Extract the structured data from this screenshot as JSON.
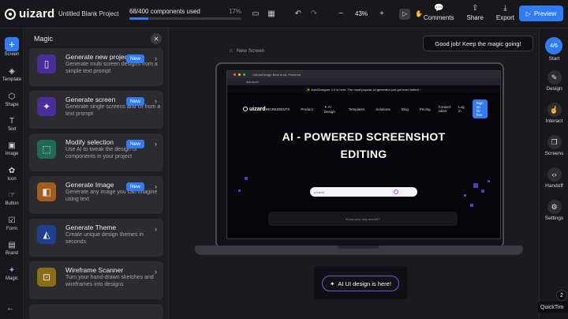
{
  "app": {
    "logo_text": "uizard",
    "project_title": "Untitled Blank Project",
    "usage_text": "68/400 components used",
    "usage_percent": "17%",
    "usage_fraction": 0.17,
    "zoom_level": "43%",
    "actions": [
      {
        "label": "Comments",
        "icon": "comment-icon"
      },
      {
        "label": "Share",
        "icon": "share-icon"
      },
      {
        "label": "Export",
        "icon": "download-icon"
      }
    ],
    "preview_label": "Preview",
    "accent_color": "#2f7cf6"
  },
  "left_rail": [
    {
      "label": "Screen",
      "icon": "plus-icon"
    },
    {
      "label": "Template",
      "icon": "layers-icon"
    },
    {
      "label": "Shape",
      "icon": "shape-icon"
    },
    {
      "label": "Text",
      "icon": "text-icon"
    },
    {
      "label": "Image",
      "icon": "image-icon"
    },
    {
      "label": "Icon",
      "icon": "icon-icon"
    },
    {
      "label": "Button",
      "icon": "button-icon"
    },
    {
      "label": "Form",
      "icon": "form-icon"
    },
    {
      "label": "Brand",
      "icon": "brand-icon"
    },
    {
      "label": "Magic",
      "icon": "magic-icon"
    }
  ],
  "panel": {
    "title": "Magic",
    "cards": [
      {
        "title": "Generate new project",
        "desc": "Generate multi screen designs from a simple text prompt",
        "badge": "New",
        "icon_color": "#6b3fd6"
      },
      {
        "title": "Generate screen",
        "desc": "Generate single screens and UI from a text prompt",
        "badge": "New",
        "icon_color": "#6b3fd6"
      },
      {
        "title": "Modify selection",
        "desc": "Use AI to tweak the design of components in your project",
        "badge": "New",
        "icon_color": "#1f8a6b"
      },
      {
        "title": "Generate Image",
        "desc": "Generate any image you can imagine using text",
        "badge": "New",
        "icon_color": "#d9822b"
      },
      {
        "title": "Generate Theme",
        "desc": "Create unique design themes in seconds",
        "badge": "",
        "icon_color": "#2f5fd6"
      },
      {
        "title": "Wireframe Scanner",
        "desc": "Turn your hand-drawn sketches and wireframes into designs",
        "badge": "",
        "icon_color": "#c9a227"
      }
    ]
  },
  "canvas": {
    "toast": "Good job! Keep the magic going!",
    "screen_label": "New Screen",
    "browser": {
      "tab_text": "UiAutoDesign Beta Area, Powered",
      "address": "aiautocle",
      "announce": "✨ AutoDesigner 2.0 is here. The most popular UI generator just got even better! ›",
      "nav_logo": "uizard",
      "nav_links": [
        "INGREDIENTS",
        "Product",
        "✦ AI Design",
        "Templates",
        "Solutions",
        "Blog"
      ],
      "nav_right": [
        "Pricing",
        "Contact sales",
        "Log in"
      ],
      "signup": "Sign up for free",
      "hero_line1": "AI - POWERED SCREENSHOT",
      "hero_line2": "EDITING",
      "input_text": "a travel",
      "strip_text": "Know your way around?"
    },
    "ai_button": "AI UI design is here!"
  },
  "right_rail": {
    "progress": "4/6",
    "start_label": "Start",
    "items": [
      {
        "label": "Design",
        "icon": "pencil-icon"
      },
      {
        "label": "Interact",
        "icon": "pointer-icon"
      },
      {
        "label": "Screens",
        "icon": "screens-icon"
      },
      {
        "label": "Handoff",
        "icon": "code-icon"
      },
      {
        "label": "Settings",
        "icon": "gear-icon"
      }
    ]
  },
  "quicktime": {
    "label": "QuickTim",
    "count": "2"
  }
}
